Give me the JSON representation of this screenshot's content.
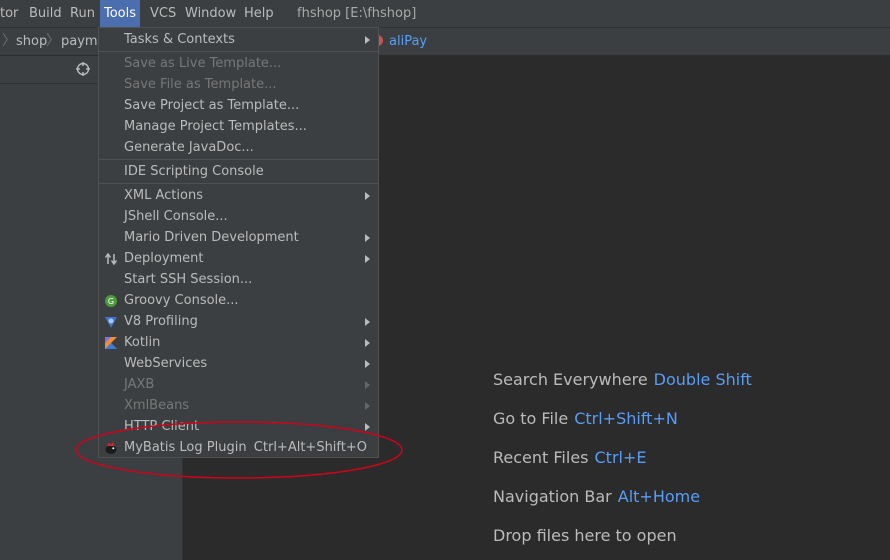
{
  "menubar": {
    "items": [
      "tor",
      "Build",
      "Run",
      "Tools",
      "VCS",
      "Window",
      "Help"
    ],
    "active": "Tools",
    "title": "fhshop [E:\\fhshop]"
  },
  "navbar": {
    "crumbs": [
      "shop",
      "payme"
    ],
    "file": "aliPay"
  },
  "tools_menu": {
    "items": [
      {
        "label": "Tasks & Contexts",
        "submenu": true
      },
      {
        "label": "Save as Live Template...",
        "disabled": true
      },
      {
        "label": "Save File as Template...",
        "disabled": true
      },
      {
        "label": "Save Project as Template..."
      },
      {
        "label": "Manage Project Templates..."
      },
      {
        "label": "Generate JavaDoc..."
      },
      {
        "label": "IDE Scripting Console"
      },
      {
        "label": "XML Actions",
        "submenu": true
      },
      {
        "label": "JShell Console..."
      },
      {
        "label": "Mario Driven Development",
        "submenu": true
      },
      {
        "label": "Deployment",
        "submenu": true,
        "icon": "deployment-arrows-icon"
      },
      {
        "label": "Start SSH Session..."
      },
      {
        "label": "Groovy Console...",
        "icon": "groovy-icon"
      },
      {
        "label": "V8 Profiling",
        "submenu": true,
        "icon": "v8-icon"
      },
      {
        "label": "Kotlin",
        "submenu": true,
        "icon": "kotlin-icon"
      },
      {
        "label": "WebServices",
        "submenu": true
      },
      {
        "label": "JAXB",
        "submenu": true,
        "disabled": true
      },
      {
        "label": "XmlBeans",
        "submenu": true,
        "disabled": true
      },
      {
        "label": "HTTP Client",
        "submenu": true
      },
      {
        "label": "MyBatis Log Plugin",
        "shortcut": "Ctrl+Alt+Shift+O",
        "icon": "mybatis-bird-icon"
      }
    ]
  },
  "welcome": {
    "hints": [
      {
        "label": "Search Everywhere",
        "key": "Double Shift"
      },
      {
        "label": "Go to File",
        "key": "Ctrl+Shift+N"
      },
      {
        "label": "Recent Files",
        "key": "Ctrl+E"
      },
      {
        "label": "Navigation Bar",
        "key": "Alt+Home"
      },
      {
        "label": "Drop files here to open",
        "key": ""
      }
    ]
  },
  "colors": {
    "accent": "#4b6eaf",
    "link": "#589df6",
    "annotation": "#d0021b"
  }
}
